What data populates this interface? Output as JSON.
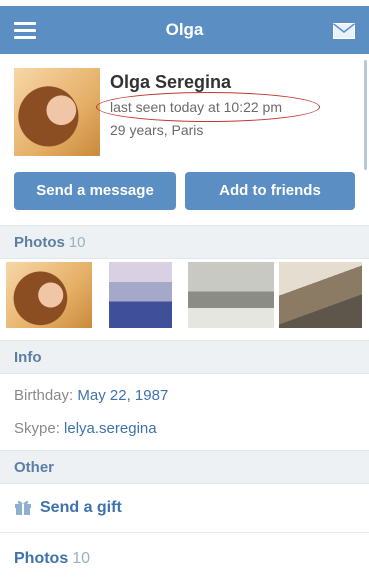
{
  "header": {
    "title": "Olga",
    "menu_icon": "hamburger-menu-icon",
    "mail_icon": "envelope-icon",
    "color": "#5b8fc3"
  },
  "profile": {
    "name": "Olga Seregina",
    "last_seen": "last seen today at 10:22 pm",
    "details": "29 years, Paris",
    "send_message_label": "Send a message",
    "add_friends_label": "Add to friends"
  },
  "photos": {
    "label": "Photos",
    "count": "10"
  },
  "info": {
    "label": "Info",
    "birthday_label": "Birthday:",
    "birthday_month_day": "May 22",
    "birthday_year": "1987",
    "skype_label": "Skype:",
    "skype_value": "lelya.seregina"
  },
  "other": {
    "label": "Other",
    "gift_label": "Send a gift",
    "gift_icon": "gift-icon",
    "photos_label": "Photos",
    "photos_count": "10"
  },
  "accent_link_color": "#3f72ad"
}
